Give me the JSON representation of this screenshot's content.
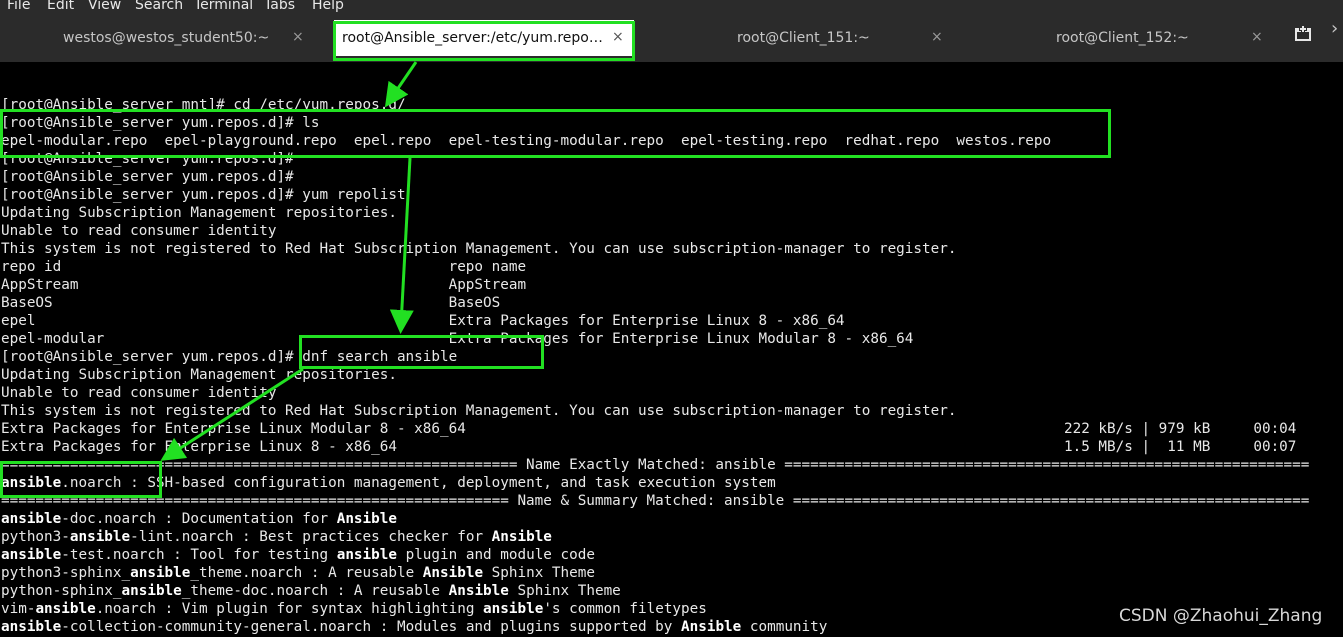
{
  "menu": [
    "File",
    "Edit",
    "View",
    "Search",
    "Terminal",
    "Tabs",
    "Help"
  ],
  "tabs": [
    {
      "label": "westos@westos_student50:~",
      "close": "×",
      "active": false
    },
    {
      "label": "root@Ansible_server:/etc/yum.repo…",
      "close": "×",
      "active": true
    },
    {
      "label": "root@Client_151:~",
      "close": "×",
      "active": false
    },
    {
      "label": "root@Client_152:~",
      "close": "×",
      "active": false
    }
  ],
  "terminal": {
    "lines": [
      "[root@Ansible_server mnt]# cd /etc/yum.repos.d/",
      "[root@Ansible_server yum.repos.d]# ls",
      "epel-modular.repo  epel-playground.repo  epel.repo  epel-testing-modular.repo  epel-testing.repo  redhat.repo  westos.repo",
      "[root@Ansible_server yum.repos.d]#",
      "[root@Ansible_server yum.repos.d]#",
      "[root@Ansible_server yum.repos.d]# yum repolist",
      "Updating Subscription Management repositories.",
      "Unable to read consumer identity",
      "This system is not registered to Red Hat Subscription Management. You can use subscription-manager to register.",
      "repo id                                             repo name",
      "AppStream                                           AppStream",
      "BaseOS                                              BaseOS",
      "epel                                                Extra Packages for Enterprise Linux 8 - x86_64",
      "epel-modular                                        Extra Packages for Enterprise Linux Modular 8 - x86_64",
      "[root@Ansible_server yum.repos.d]# dnf search ansible",
      "Updating Subscription Management repositories.",
      "Unable to read consumer identity",
      "This system is not registered to Red Hat Subscription Management. You can use subscription-manager to register.",
      "Extra Packages for Enterprise Linux Modular 8 - x86_64",
      "Extra Packages for Enterprise Linux 8 - x86_64",
      "============================================================ Name Exactly Matched: ansible =============================================================",
      null,
      "=========================================================== Name & Summary Matched: ansible ============================================================",
      null,
      null,
      null,
      null,
      null,
      null,
      null,
      null
    ],
    "download_stats": [
      "222 kB/s | 979 kB     00:04",
      "1.5 MB/s |  11 MB     00:07"
    ],
    "search_results": [
      {
        "segments": [
          {
            "t": "ansible",
            "b": true
          },
          {
            "t": ".noarch : SSH-based configuration management, deployment, and task execution system",
            "b": false
          }
        ]
      },
      {
        "segments": [
          {
            "t": "ansible",
            "b": true
          },
          {
            "t": "-doc.noarch : Documentation for ",
            "b": false
          },
          {
            "t": "Ansible",
            "b": true
          }
        ]
      },
      {
        "segments": [
          {
            "t": "python3-",
            "b": false
          },
          {
            "t": "ansible",
            "b": true
          },
          {
            "t": "-lint.noarch : Best practices checker for ",
            "b": false
          },
          {
            "t": "Ansible",
            "b": true
          }
        ]
      },
      {
        "segments": [
          {
            "t": "ansible",
            "b": true
          },
          {
            "t": "-test.noarch : Tool for testing ",
            "b": false
          },
          {
            "t": "ansible",
            "b": true
          },
          {
            "t": " plugin and module code",
            "b": false
          }
        ]
      },
      {
        "segments": [
          {
            "t": "python3-sphinx_",
            "b": false
          },
          {
            "t": "ansible",
            "b": true
          },
          {
            "t": "_theme.noarch : A reusable ",
            "b": false
          },
          {
            "t": "Ansible",
            "b": true
          },
          {
            "t": " Sphinx Theme",
            "b": false
          }
        ]
      },
      {
        "segments": [
          {
            "t": "python-sphinx_",
            "b": false
          },
          {
            "t": "ansible",
            "b": true
          },
          {
            "t": "_theme-doc.noarch : A reusable ",
            "b": false
          },
          {
            "t": "Ansible",
            "b": true
          },
          {
            "t": " Sphinx Theme",
            "b": false
          }
        ]
      },
      {
        "segments": [
          {
            "t": "vim-",
            "b": false
          },
          {
            "t": "ansible",
            "b": true
          },
          {
            "t": ".noarch : Vim plugin for syntax highlighting ",
            "b": false
          },
          {
            "t": "ansible",
            "b": true
          },
          {
            "t": "'s common filetypes",
            "b": false
          }
        ]
      },
      {
        "segments": [
          {
            "t": "ansible",
            "b": true
          },
          {
            "t": "-collection-community-general.noarch : Modules and plugins supported by ",
            "b": false
          },
          {
            "t": "Ansible",
            "b": true
          },
          {
            "t": " community",
            "b": false
          }
        ]
      }
    ]
  },
  "watermark": "CSDN @Zhaohui_Zhang",
  "colors": {
    "highlight": "#22e022",
    "terminal_bg": "#000000",
    "terminal_fg": "#e8e8e8",
    "tabbar_bg": "#2b2b2b"
  },
  "icons": [
    "new-tab-icon",
    "close-icon",
    "scroll-right-icon",
    "annotation-arrow-icon"
  ]
}
